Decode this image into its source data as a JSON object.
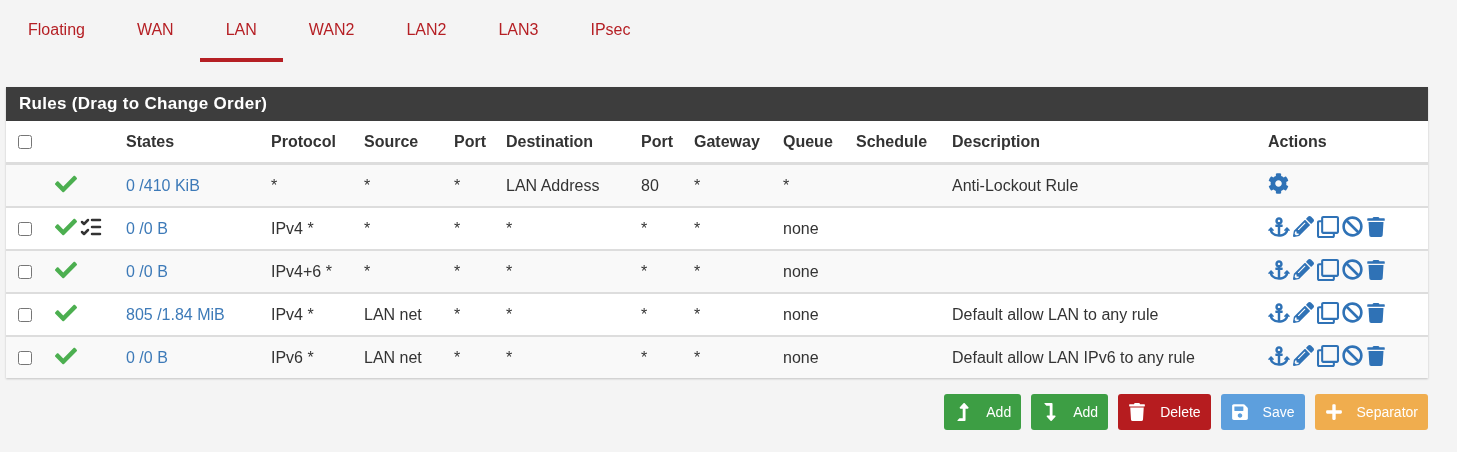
{
  "tabs": [
    {
      "label": "Floating",
      "selected": false
    },
    {
      "label": "WAN",
      "selected": false
    },
    {
      "label": "LAN",
      "selected": true
    },
    {
      "label": "WAN2",
      "selected": false
    },
    {
      "label": "LAN2",
      "selected": false
    },
    {
      "label": "LAN3",
      "selected": false
    },
    {
      "label": "IPsec",
      "selected": false
    }
  ],
  "panel": {
    "title": "Rules (Drag to Change Order)",
    "select_all": {
      "checked": false
    },
    "columns": [
      "States",
      "Protocol",
      "Source",
      "Port",
      "Destination",
      "Port",
      "Gateway",
      "Queue",
      "Schedule",
      "Description",
      "Actions"
    ],
    "rows": [
      {
        "kind": "locked",
        "enabled": true,
        "advanced": false,
        "states": "0 /410 KiB",
        "protocol": "*",
        "source": "*",
        "port": "*",
        "destination": "LAN Address",
        "dest_port": "80",
        "gateway": "*",
        "queue": "*",
        "description": "Anti-Lockout Rule"
      },
      {
        "kind": "rule",
        "checked": false,
        "enabled": true,
        "advanced": true,
        "states": "0 /0 B",
        "protocol": "IPv4 *",
        "source": "*",
        "port": "*",
        "destination": "*",
        "dest_port": "*",
        "gateway": "*",
        "queue": "none"
      },
      {
        "kind": "rule",
        "checked": false,
        "enabled": true,
        "advanced": false,
        "states": "0 /0 B",
        "protocol": "IPv4+6 *",
        "source": "*",
        "port": "*",
        "destination": "*",
        "dest_port": "*",
        "gateway": "*",
        "queue": "none"
      },
      {
        "kind": "rule",
        "checked": false,
        "enabled": true,
        "advanced": false,
        "states": "805 /1.84 MiB",
        "protocol": "IPv4 *",
        "source": "LAN net",
        "port": "*",
        "destination": "*",
        "dest_port": "*",
        "gateway": "*",
        "queue": "none",
        "description": "Default allow LAN to any rule"
      },
      {
        "kind": "rule",
        "checked": false,
        "enabled": true,
        "advanced": false,
        "states": "0 /0 B",
        "protocol": "IPv6 *",
        "source": "LAN net",
        "port": "*",
        "destination": "*",
        "dest_port": "*",
        "gateway": "*",
        "queue": "none",
        "description": "Default allow LAN IPv6 to any rule"
      }
    ]
  },
  "buttons": [
    {
      "kind": "add-top",
      "label": "Add"
    },
    {
      "kind": "add-bottom",
      "label": "Add"
    },
    {
      "kind": "delete",
      "label": "Delete"
    },
    {
      "kind": "save",
      "label": "Save"
    },
    {
      "kind": "separator",
      "label": "Separator"
    }
  ]
}
